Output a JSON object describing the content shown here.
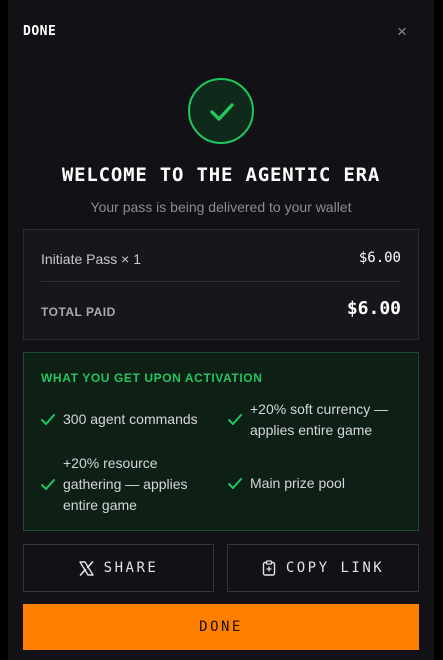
{
  "header": {
    "title": "DONE",
    "close_glyph": "×"
  },
  "hero": {
    "icon": "check-icon",
    "title": "WELCOME TO THE AGENTIC ERA",
    "subtitle": "Your pass is being delivered to your wallet"
  },
  "summary": {
    "item_label": "Initiate Pass × 1",
    "item_price": "$6.00",
    "total_label": "TOTAL PAID",
    "total_value": "$6.00"
  },
  "benefits": {
    "title": "WHAT YOU GET UPON ACTIVATION",
    "items": [
      {
        "lines": [
          "300 agent commands"
        ]
      },
      {
        "lines": [
          "+20% soft currency —",
          "applies entire game"
        ]
      },
      {
        "lines": [
          "+20% resource",
          "gathering — applies",
          "entire game"
        ]
      },
      {
        "lines": [
          "Main prize pool"
        ]
      }
    ]
  },
  "actions": {
    "share_label": "SHARE",
    "share_icon": "x-logo-icon",
    "copy_label": "COPY LINK",
    "copy_icon": "clipboard-icon",
    "done_label": "DONE"
  },
  "colors": {
    "accent_green": "#22c55e",
    "accent_orange": "#ff7f00",
    "background": "#121216"
  }
}
